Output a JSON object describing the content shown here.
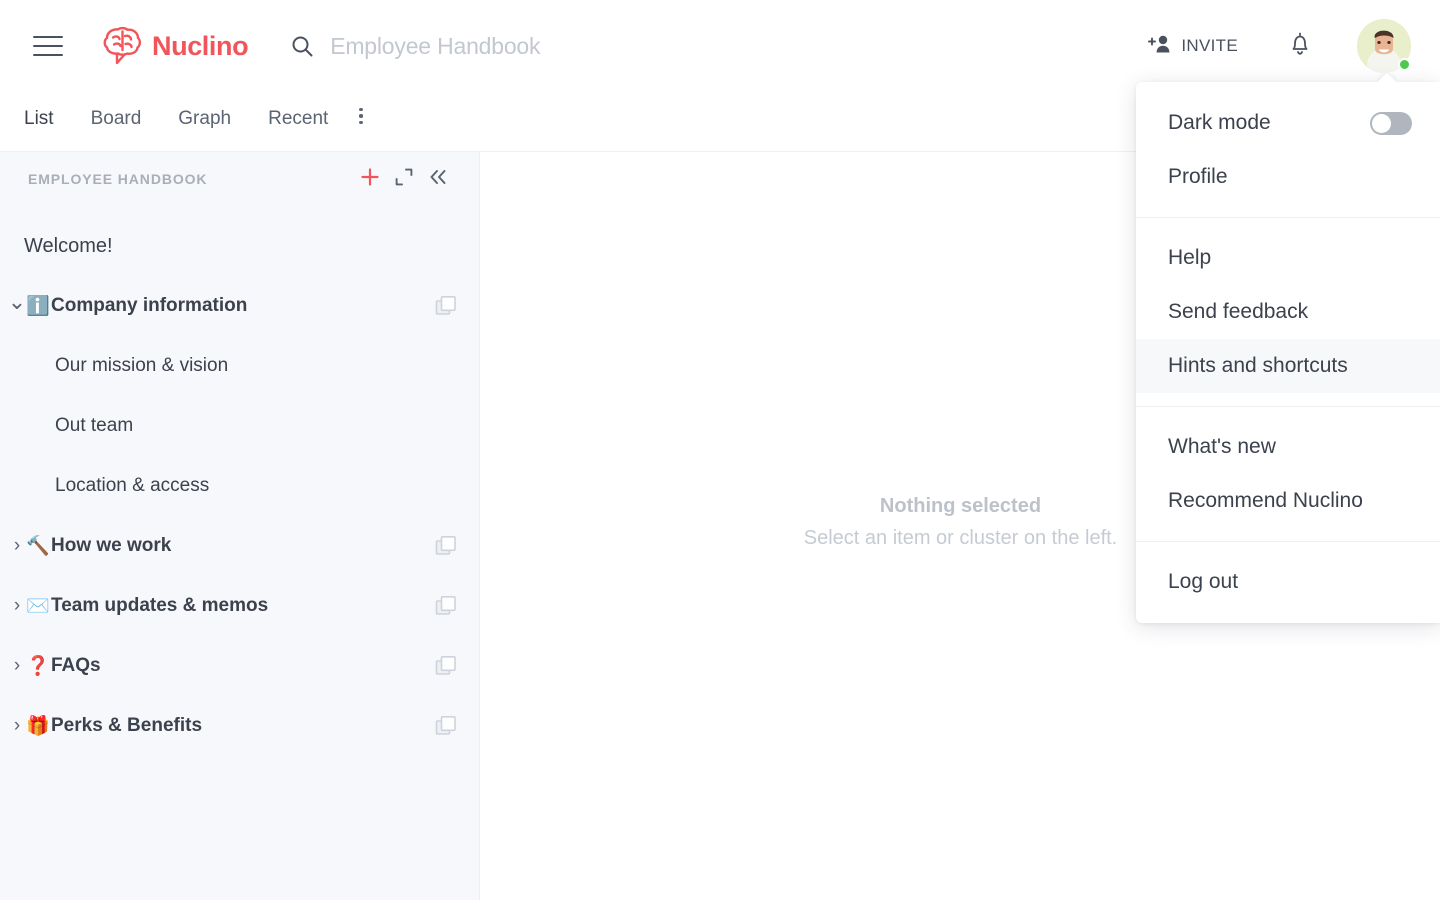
{
  "colors": {
    "accent": "#f2545b",
    "text": "#3c424d",
    "muted": "#a9aeb8",
    "sidebar_bg": "#f7f8fb",
    "status_online": "#4ec94e"
  },
  "header": {
    "menu_icon": "hamburger-icon",
    "brand": "Nuclino",
    "brand_icon": "nuclino-brain-logo",
    "search": {
      "icon": "search-icon",
      "value": "",
      "placeholder": "Employee Handbook"
    },
    "invite": {
      "label": "INVITE",
      "icon": "add-person-icon"
    },
    "notifications_icon": "bell-icon",
    "avatar": {
      "name": "avatar",
      "status": "online"
    }
  },
  "tabs": {
    "items": [
      {
        "label": "List",
        "active": true
      },
      {
        "label": "Board",
        "active": false
      },
      {
        "label": "Graph",
        "active": false
      },
      {
        "label": "Recent",
        "active": false
      }
    ],
    "more_icon": "more-vertical-icon"
  },
  "sidebar": {
    "title": "EMPLOYEE HANDBOOK",
    "actions": [
      {
        "name": "add-item-button",
        "icon": "plus-icon"
      },
      {
        "name": "expand-button",
        "icon": "expand-icon"
      },
      {
        "name": "collapse-sidebar-button",
        "icon": "chevrons-left-icon"
      }
    ],
    "tree": [
      {
        "label": "Welcome!",
        "kind": "plain",
        "emoji": "",
        "expanded": null,
        "cluster_icon": false
      },
      {
        "label": "Company information",
        "kind": "cluster",
        "emoji": "ℹ️",
        "expanded": true,
        "cluster_icon": true
      },
      {
        "label": "Our mission & vision",
        "kind": "leaf",
        "emoji": "",
        "expanded": null,
        "cluster_icon": false
      },
      {
        "label": "Out team",
        "kind": "leaf",
        "emoji": "",
        "expanded": null,
        "cluster_icon": false
      },
      {
        "label": "Location & access",
        "kind": "leaf",
        "emoji": "",
        "expanded": null,
        "cluster_icon": false
      },
      {
        "label": "How we work",
        "kind": "cluster",
        "emoji": "🔨",
        "expanded": false,
        "cluster_icon": true
      },
      {
        "label": "Team updates & memos",
        "kind": "cluster",
        "emoji": "✉️",
        "expanded": false,
        "cluster_icon": true
      },
      {
        "label": "FAQs",
        "kind": "cluster",
        "emoji": "❓",
        "expanded": false,
        "cluster_icon": true
      },
      {
        "label": "Perks & Benefits",
        "kind": "cluster",
        "emoji": "🎁",
        "expanded": false,
        "cluster_icon": true
      }
    ]
  },
  "main": {
    "empty_title": "Nothing selected",
    "empty_subtitle": "Select an item or cluster on the left."
  },
  "account_menu": {
    "dark_mode": {
      "label": "Dark mode",
      "enabled": false
    },
    "profile": "Profile",
    "help": "Help",
    "send_feedback": "Send feedback",
    "hints_and_shortcuts": "Hints and shortcuts",
    "whats_new": "What's new",
    "recommend": "Recommend Nuclino",
    "log_out": "Log out"
  }
}
